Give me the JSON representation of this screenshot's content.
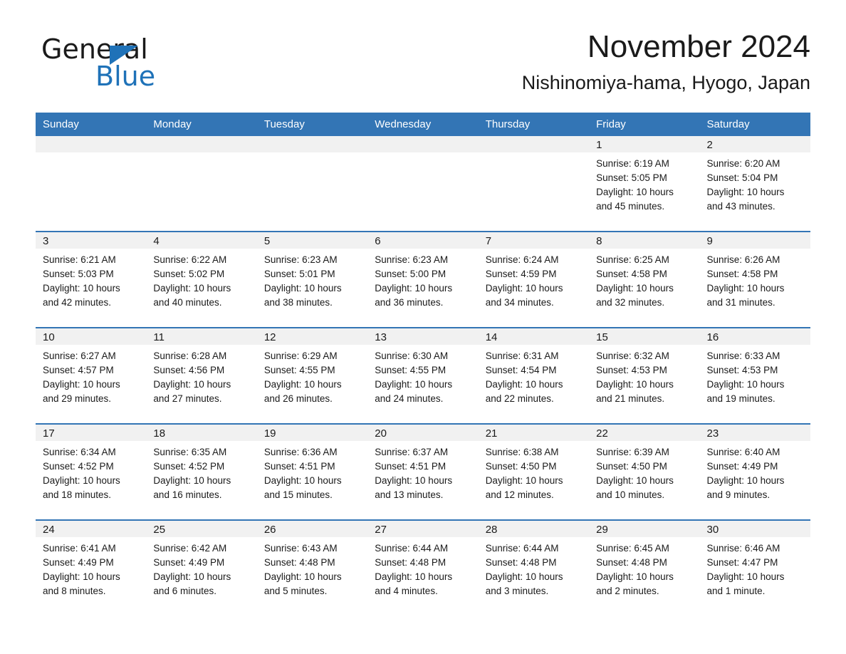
{
  "brand": {
    "line1": "General",
    "line2": "Blue",
    "triangle_icon": "triangle-icon",
    "color_black": "#1a1a1a",
    "color_blue": "#1f72b8"
  },
  "header": {
    "month_title": "November 2024",
    "location": "Nishinomiya-hama, Hyogo, Japan"
  },
  "theme": {
    "header_blue": "#3375b5",
    "daynum_band": "#f1f1f1",
    "text": "#1a1a1a",
    "background": "#ffffff"
  },
  "weekday_headers": [
    "Sunday",
    "Monday",
    "Tuesday",
    "Wednesday",
    "Thursday",
    "Friday",
    "Saturday"
  ],
  "weeks": [
    [
      {
        "day": "",
        "sunrise": "",
        "sunset": "",
        "daylight_line1": "",
        "daylight_line2": ""
      },
      {
        "day": "",
        "sunrise": "",
        "sunset": "",
        "daylight_line1": "",
        "daylight_line2": ""
      },
      {
        "day": "",
        "sunrise": "",
        "sunset": "",
        "daylight_line1": "",
        "daylight_line2": ""
      },
      {
        "day": "",
        "sunrise": "",
        "sunset": "",
        "daylight_line1": "",
        "daylight_line2": ""
      },
      {
        "day": "",
        "sunrise": "",
        "sunset": "",
        "daylight_line1": "",
        "daylight_line2": ""
      },
      {
        "day": "1",
        "sunrise": "Sunrise: 6:19 AM",
        "sunset": "Sunset: 5:05 PM",
        "daylight_line1": "Daylight: 10 hours",
        "daylight_line2": "and 45 minutes."
      },
      {
        "day": "2",
        "sunrise": "Sunrise: 6:20 AM",
        "sunset": "Sunset: 5:04 PM",
        "daylight_line1": "Daylight: 10 hours",
        "daylight_line2": "and 43 minutes."
      }
    ],
    [
      {
        "day": "3",
        "sunrise": "Sunrise: 6:21 AM",
        "sunset": "Sunset: 5:03 PM",
        "daylight_line1": "Daylight: 10 hours",
        "daylight_line2": "and 42 minutes."
      },
      {
        "day": "4",
        "sunrise": "Sunrise: 6:22 AM",
        "sunset": "Sunset: 5:02 PM",
        "daylight_line1": "Daylight: 10 hours",
        "daylight_line2": "and 40 minutes."
      },
      {
        "day": "5",
        "sunrise": "Sunrise: 6:23 AM",
        "sunset": "Sunset: 5:01 PM",
        "daylight_line1": "Daylight: 10 hours",
        "daylight_line2": "and 38 minutes."
      },
      {
        "day": "6",
        "sunrise": "Sunrise: 6:23 AM",
        "sunset": "Sunset: 5:00 PM",
        "daylight_line1": "Daylight: 10 hours",
        "daylight_line2": "and 36 minutes."
      },
      {
        "day": "7",
        "sunrise": "Sunrise: 6:24 AM",
        "sunset": "Sunset: 4:59 PM",
        "daylight_line1": "Daylight: 10 hours",
        "daylight_line2": "and 34 minutes."
      },
      {
        "day": "8",
        "sunrise": "Sunrise: 6:25 AM",
        "sunset": "Sunset: 4:58 PM",
        "daylight_line1": "Daylight: 10 hours",
        "daylight_line2": "and 32 minutes."
      },
      {
        "day": "9",
        "sunrise": "Sunrise: 6:26 AM",
        "sunset": "Sunset: 4:58 PM",
        "daylight_line1": "Daylight: 10 hours",
        "daylight_line2": "and 31 minutes."
      }
    ],
    [
      {
        "day": "10",
        "sunrise": "Sunrise: 6:27 AM",
        "sunset": "Sunset: 4:57 PM",
        "daylight_line1": "Daylight: 10 hours",
        "daylight_line2": "and 29 minutes."
      },
      {
        "day": "11",
        "sunrise": "Sunrise: 6:28 AM",
        "sunset": "Sunset: 4:56 PM",
        "daylight_line1": "Daylight: 10 hours",
        "daylight_line2": "and 27 minutes."
      },
      {
        "day": "12",
        "sunrise": "Sunrise: 6:29 AM",
        "sunset": "Sunset: 4:55 PM",
        "daylight_line1": "Daylight: 10 hours",
        "daylight_line2": "and 26 minutes."
      },
      {
        "day": "13",
        "sunrise": "Sunrise: 6:30 AM",
        "sunset": "Sunset: 4:55 PM",
        "daylight_line1": "Daylight: 10 hours",
        "daylight_line2": "and 24 minutes."
      },
      {
        "day": "14",
        "sunrise": "Sunrise: 6:31 AM",
        "sunset": "Sunset: 4:54 PM",
        "daylight_line1": "Daylight: 10 hours",
        "daylight_line2": "and 22 minutes."
      },
      {
        "day": "15",
        "sunrise": "Sunrise: 6:32 AM",
        "sunset": "Sunset: 4:53 PM",
        "daylight_line1": "Daylight: 10 hours",
        "daylight_line2": "and 21 minutes."
      },
      {
        "day": "16",
        "sunrise": "Sunrise: 6:33 AM",
        "sunset": "Sunset: 4:53 PM",
        "daylight_line1": "Daylight: 10 hours",
        "daylight_line2": "and 19 minutes."
      }
    ],
    [
      {
        "day": "17",
        "sunrise": "Sunrise: 6:34 AM",
        "sunset": "Sunset: 4:52 PM",
        "daylight_line1": "Daylight: 10 hours",
        "daylight_line2": "and 18 minutes."
      },
      {
        "day": "18",
        "sunrise": "Sunrise: 6:35 AM",
        "sunset": "Sunset: 4:52 PM",
        "daylight_line1": "Daylight: 10 hours",
        "daylight_line2": "and 16 minutes."
      },
      {
        "day": "19",
        "sunrise": "Sunrise: 6:36 AM",
        "sunset": "Sunset: 4:51 PM",
        "daylight_line1": "Daylight: 10 hours",
        "daylight_line2": "and 15 minutes."
      },
      {
        "day": "20",
        "sunrise": "Sunrise: 6:37 AM",
        "sunset": "Sunset: 4:51 PM",
        "daylight_line1": "Daylight: 10 hours",
        "daylight_line2": "and 13 minutes."
      },
      {
        "day": "21",
        "sunrise": "Sunrise: 6:38 AM",
        "sunset": "Sunset: 4:50 PM",
        "daylight_line1": "Daylight: 10 hours",
        "daylight_line2": "and 12 minutes."
      },
      {
        "day": "22",
        "sunrise": "Sunrise: 6:39 AM",
        "sunset": "Sunset: 4:50 PM",
        "daylight_line1": "Daylight: 10 hours",
        "daylight_line2": "and 10 minutes."
      },
      {
        "day": "23",
        "sunrise": "Sunrise: 6:40 AM",
        "sunset": "Sunset: 4:49 PM",
        "daylight_line1": "Daylight: 10 hours",
        "daylight_line2": "and 9 minutes."
      }
    ],
    [
      {
        "day": "24",
        "sunrise": "Sunrise: 6:41 AM",
        "sunset": "Sunset: 4:49 PM",
        "daylight_line1": "Daylight: 10 hours",
        "daylight_line2": "and 8 minutes."
      },
      {
        "day": "25",
        "sunrise": "Sunrise: 6:42 AM",
        "sunset": "Sunset: 4:49 PM",
        "daylight_line1": "Daylight: 10 hours",
        "daylight_line2": "and 6 minutes."
      },
      {
        "day": "26",
        "sunrise": "Sunrise: 6:43 AM",
        "sunset": "Sunset: 4:48 PM",
        "daylight_line1": "Daylight: 10 hours",
        "daylight_line2": "and 5 minutes."
      },
      {
        "day": "27",
        "sunrise": "Sunrise: 6:44 AM",
        "sunset": "Sunset: 4:48 PM",
        "daylight_line1": "Daylight: 10 hours",
        "daylight_line2": "and 4 minutes."
      },
      {
        "day": "28",
        "sunrise": "Sunrise: 6:44 AM",
        "sunset": "Sunset: 4:48 PM",
        "daylight_line1": "Daylight: 10 hours",
        "daylight_line2": "and 3 minutes."
      },
      {
        "day": "29",
        "sunrise": "Sunrise: 6:45 AM",
        "sunset": "Sunset: 4:48 PM",
        "daylight_line1": "Daylight: 10 hours",
        "daylight_line2": "and 2 minutes."
      },
      {
        "day": "30",
        "sunrise": "Sunrise: 6:46 AM",
        "sunset": "Sunset: 4:47 PM",
        "daylight_line1": "Daylight: 10 hours",
        "daylight_line2": "and 1 minute."
      }
    ]
  ]
}
